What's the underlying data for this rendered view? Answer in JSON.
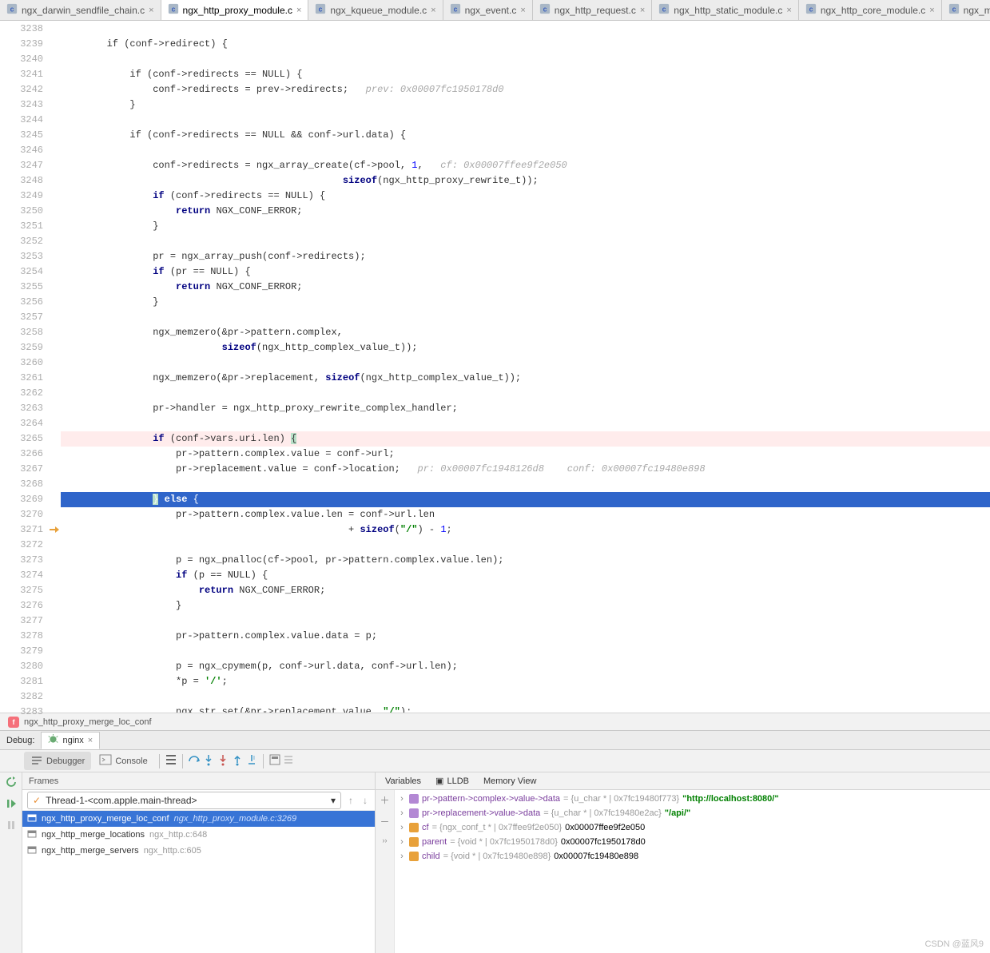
{
  "tabs": [
    {
      "name": "ngx_darwin_sendfile_chain.c",
      "active": false
    },
    {
      "name": "ngx_http_proxy_module.c",
      "active": true
    },
    {
      "name": "ngx_kqueue_module.c",
      "active": false
    },
    {
      "name": "ngx_event.c",
      "active": false
    },
    {
      "name": "ngx_http_request.c",
      "active": false
    },
    {
      "name": "ngx_http_static_module.c",
      "active": false
    },
    {
      "name": "ngx_http_core_module.c",
      "active": false
    },
    {
      "name": "ngx_modu",
      "active": false
    }
  ],
  "gutter_start": 3238,
  "gutter_end": 3283,
  "breakpoint_line": 3265,
  "exec_line": 3269,
  "code_lines": [
    "",
    "    if (conf->redirect) {",
    "",
    "        if (conf->redirects == NULL) {",
    "            conf->redirects = prev->redirects;   <span class='cmt'>prev: 0x00007fc1950178d0</span>",
    "        }",
    "",
    "        if (conf->redirects == NULL && conf->url.data) {",
    "",
    "            conf->redirects = ngx_array_create(cf->pool, <span class='num'>1</span>,   <span class='cmt'>cf: 0x00007ffee9f2e050</span>",
    "                                             <span class='kw'>sizeof</span>(ngx_http_proxy_rewrite_t));",
    "            <span class='kw'>if</span> (conf->redirects == NULL) {",
    "                <span class='kw'>return</span> NGX_CONF_ERROR;",
    "            }",
    "",
    "            pr = ngx_array_push(conf->redirects);",
    "            <span class='kw'>if</span> (pr == NULL) {",
    "                <span class='kw'>return</span> NGX_CONF_ERROR;",
    "            }",
    "",
    "            ngx_memzero(&pr->pattern.complex,",
    "                        <span class='kw'>sizeof</span>(ngx_http_complex_value_t));",
    "",
    "            ngx_memzero(&pr->replacement, <span class='kw'>sizeof</span>(ngx_http_complex_value_t));",
    "",
    "            pr->handler = ngx_http_proxy_rewrite_complex_handler;",
    "",
    "            <span class='kw'>if</span> (conf->vars.uri.len) <span class='hl-brace'>{</span>",
    "                pr->pattern.complex.value = conf->url;",
    "                pr->replacement.value = conf->location;   <span class='cmt'>pr: 0x00007fc1948126d8    conf: 0x00007fc19480e898</span>",
    "",
    "            <span class='hl-brace'>}</span> <span class='kw'>else</span> {",
    "                pr->pattern.complex.value.len = conf->url.len",
    "                                              + <span class='kw'>sizeof</span>(<span class='str'>\"/\"</span>) - <span class='num'>1</span>;",
    "",
    "                p = ngx_pnalloc(cf->pool, pr->pattern.complex.value.len);",
    "                <span class='kw'>if</span> (p == NULL) {",
    "                    <span class='kw'>return</span> NGX_CONF_ERROR;",
    "                }",
    "",
    "                pr->pattern.complex.value.data = p;",
    "",
    "                p = ngx_cpymem(p, conf->url.data, conf->url.len);",
    "                *p = <span class='str'>'/'</span>;",
    "",
    "                ngx_str_set(&pr->replacement.value, <span class='str'>\"/\"</span>);"
  ],
  "breadcrumb": "ngx_http_proxy_merge_loc_conf",
  "debug_label": "Debug:",
  "run_config": "nginx",
  "toolbar": {
    "debugger": "Debugger",
    "console": "Console"
  },
  "frames_label": "Frames",
  "thread": "Thread-1-<com.apple.main-thread>",
  "stack": [
    {
      "fn": "ngx_http_proxy_merge_loc_conf",
      "loc": "ngx_http_proxy_module.c:3269",
      "sel": true
    },
    {
      "fn": "ngx_http_merge_locations",
      "loc": "ngx_http.c:648",
      "sel": false
    },
    {
      "fn": "ngx_http_merge_servers",
      "loc": "ngx_http.c:605",
      "sel": false
    }
  ],
  "vars_tabs": {
    "variables": "Variables",
    "lldb": "LLDB",
    "memory": "Memory View"
  },
  "vars": [
    {
      "ic": "p",
      "name": "pr->pattern->complex->value->data",
      "type": "= {u_char * | 0x7fc19480f773}",
      "val": "\"http://localhost:8080/\"",
      "str": true
    },
    {
      "ic": "p",
      "name": "pr->replacement->value->data",
      "type": "= {u_char * | 0x7fc19480e2ac}",
      "val": "\"/api/\"",
      "str": true
    },
    {
      "ic": "o",
      "name": "cf",
      "type": "= {ngx_conf_t * | 0x7ffee9f2e050}",
      "val": "0x00007ffee9f2e050"
    },
    {
      "ic": "o",
      "name": "parent",
      "type": "= {void * | 0x7fc1950178d0}",
      "val": "0x00007fc1950178d0"
    },
    {
      "ic": "o",
      "name": "child",
      "type": "= {void * | 0x7fc19480e898}",
      "val": "0x00007fc19480e898"
    }
  ],
  "watermark": "CSDN @蓝风9"
}
